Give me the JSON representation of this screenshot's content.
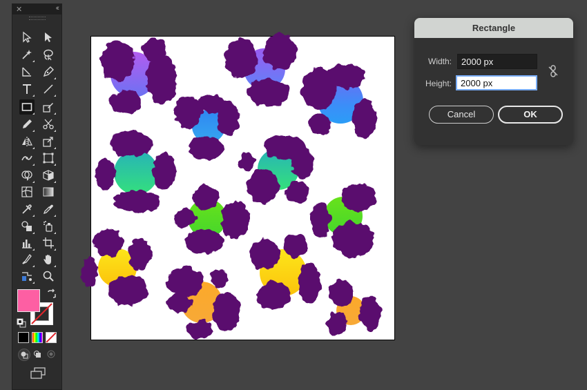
{
  "toolbar": {
    "close_icon": "close-icon",
    "collapse_icon": "collapse-icon",
    "fill_color": "#fd5fa3",
    "stroke_color": "none"
  },
  "dialog": {
    "title": "Rectangle",
    "width_label": "Width:",
    "width_value": "2000 px",
    "height_label": "Height:",
    "height_value": "2000 px",
    "constrain_icon": "link-broken-icon",
    "cancel_label": "Cancel",
    "ok_label": "OK"
  },
  "artwork": {
    "spot_color": "#5a0a6e",
    "background": "#ffffff"
  }
}
